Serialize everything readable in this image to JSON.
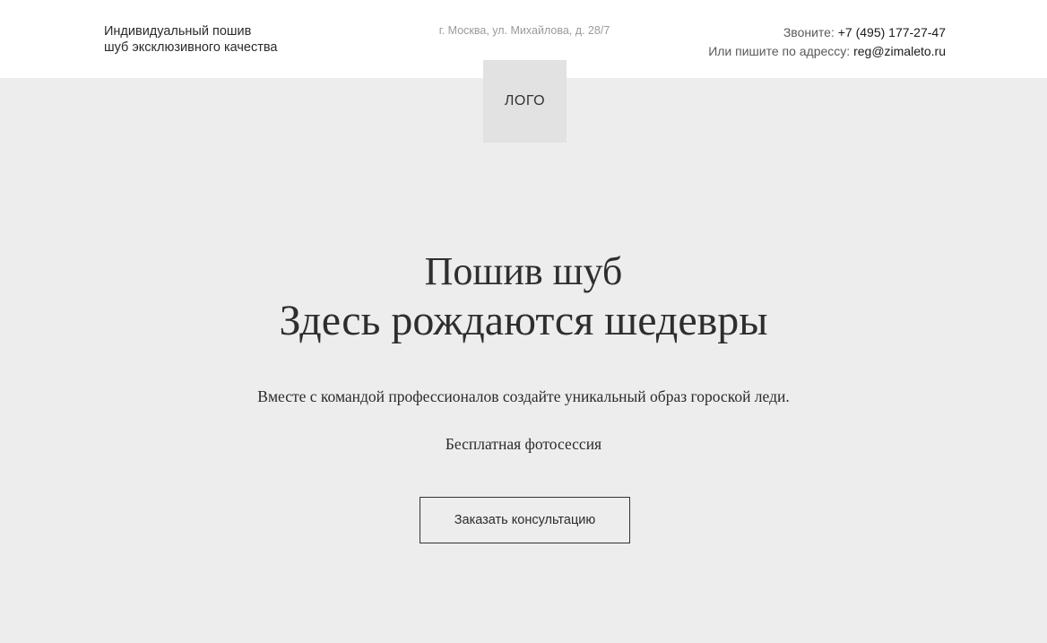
{
  "header": {
    "tagline_line1": "Индивидуальный пошив",
    "tagline_line2": "шуб эксклюзивного качества",
    "address": "г. Москва, ул. Михайлова, д. 28/7",
    "phone_label": "Звоните: ",
    "phone": "+7 (495) 177-27-47",
    "email_label": "Или пишите по адрессу: ",
    "email": "reg@zimaleto.ru"
  },
  "logo": {
    "label": "ЛОГО"
  },
  "hero": {
    "title_line1": "Пошив шуб",
    "title_line2": "Здесь рождаются шедевры",
    "subtitle": "Вместе с командой профессионалов создайте уникальный образ гороской леди.",
    "offer": "Бесплатная фотосессия",
    "cta_label": "Заказать консультацию"
  },
  "colors": {
    "header_bg": "#ffffff",
    "hero_bg": "#ededed",
    "logo_bg": "#e2e2e2",
    "text": "#333333",
    "address_text": "#9a9a9a"
  }
}
